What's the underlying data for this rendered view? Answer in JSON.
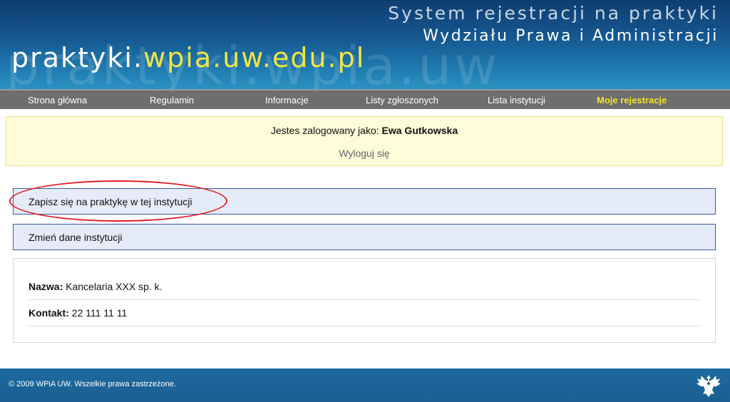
{
  "header": {
    "ghost_text": "praktyki.wpia.uw",
    "system_line1": "System rejestracji na praktyki",
    "system_line2": "Wydziału Prawa i Administracji",
    "logo_white": "praktyki.",
    "logo_yellow": "wpia.uw.edu.pl"
  },
  "nav": {
    "items": [
      {
        "label": "Strona główna"
      },
      {
        "label": "Regulamin"
      },
      {
        "label": "Informacje"
      },
      {
        "label": "Listy zgłoszonych"
      },
      {
        "label": "Lista instytucji"
      },
      {
        "label": "Moje rejestracje",
        "active": true
      }
    ]
  },
  "login": {
    "prefix": "Jestes zalogowany jako:",
    "user": "Ewa Gutkowska",
    "logout_label": "Wyloguj się"
  },
  "actions": {
    "register_label": "Zapisz się na praktykę w tej instytucji",
    "edit_label": "Zmień dane instytucji"
  },
  "details": {
    "name_label": "Nazwa:",
    "name_value": "Kancelaria XXX sp. k.",
    "contact_label": "Kontakt:",
    "contact_value": "22 111 11 11"
  },
  "footer": {
    "copyright": "© 2009 WPiA UW. Wszelkie prawa zastrzeżone.",
    "logo_icon": "eagle-emblem-icon"
  },
  "colors": {
    "header_blue": "#165a93",
    "nav_gray": "#6e6e6e",
    "active_nav": "#f0e42a",
    "login_bg": "#fdfbd8",
    "action_bg": "#e6ebf8",
    "action_border": "#3b5ca8",
    "highlight_ellipse": "#e01e24"
  }
}
